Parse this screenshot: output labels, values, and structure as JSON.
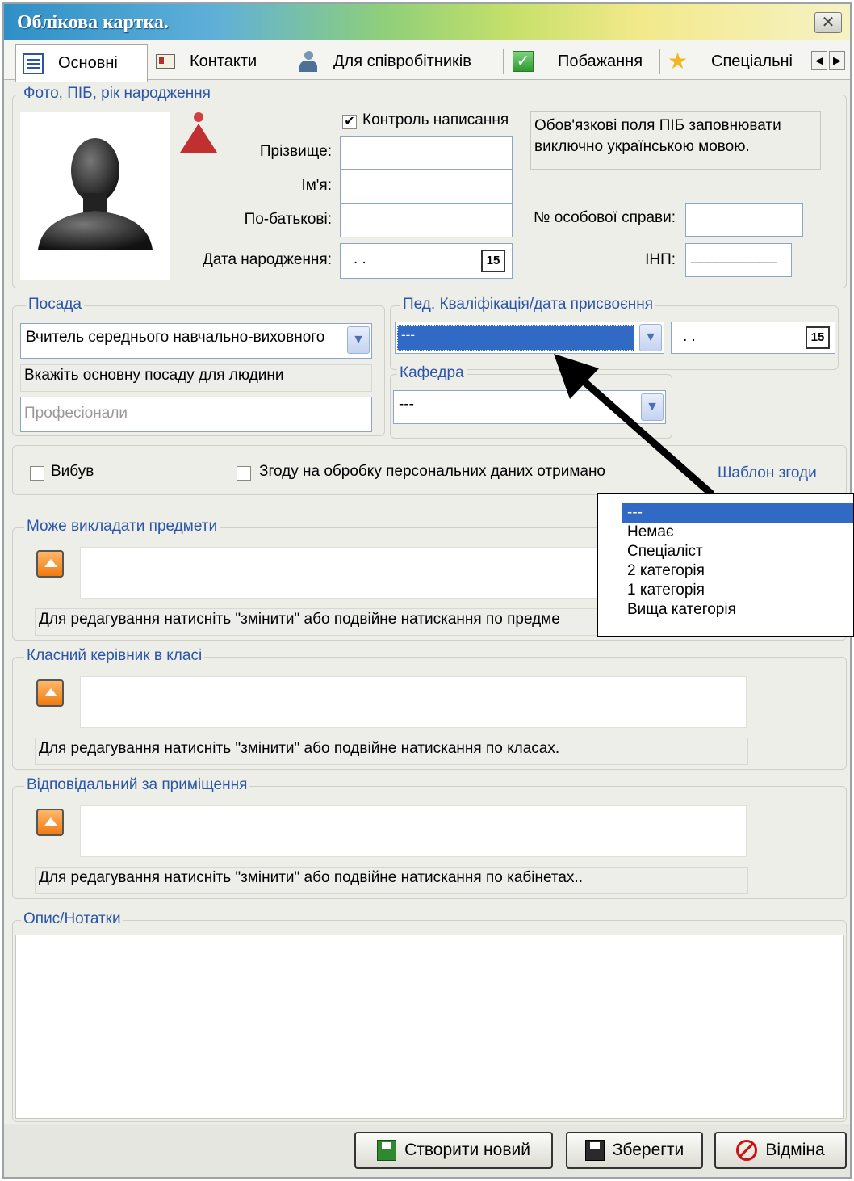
{
  "window": {
    "title": "Облікова картка.",
    "close": "✕"
  },
  "tabs": [
    {
      "label": "Основні",
      "icon": "document-icon"
    },
    {
      "label": "Контакти",
      "icon": "contact-card-icon"
    },
    {
      "label": "Для співробітників",
      "icon": "user-icon"
    },
    {
      "label": "Побажання",
      "icon": "checkmark-icon"
    },
    {
      "label": "Спеціальні",
      "icon": "star-icon"
    }
  ],
  "photo_group": {
    "label": "Фото, ПІБ, рік народження",
    "spell_check": "Контроль написання",
    "spell_check_checked": true,
    "note": "Обов'язкові поля ПІБ заповнювати виключно українською мовою.",
    "surname_label": "Прізвище:",
    "name_label": "Ім'я:",
    "patronymic_label": "По-батькові:",
    "birthdate_label": "Дата народження:",
    "birthdate_value": ". .",
    "file_no_label": "№ особової справи:",
    "inn_label": "ІНП:",
    "inn_value": "__________",
    "calendar_label": "15"
  },
  "position_group": {
    "label": "Посада",
    "value": "Вчитель середнього навчально-виховного",
    "hint": "Вкажіть основну посаду для людини",
    "category": "Професіонали"
  },
  "qualification_group": {
    "label": "Пед. Кваліфікація/дата присвоєння",
    "value": "---",
    "date_value": ". .",
    "calendar_label": "15"
  },
  "department_group": {
    "label": "Кафедра",
    "value": "---"
  },
  "retired_label": "Вибув",
  "consent_label": "Згоду на обробку персональних даних отримано",
  "consent_template_link": "Шаблон згоди",
  "subjects_group": {
    "label": "Може викладати предмети",
    "hint": "Для редагування натисніть \"змінити\" або подвійне натискання по предме"
  },
  "class_group": {
    "label": "Класний керівник в класі",
    "hint": "Для редагування натисніть \"змінити\" або подвійне натискання по класах."
  },
  "rooms_group": {
    "label": "Відповідальний за приміщення",
    "hint": "Для редагування натисніть \"змінити\" або подвійне натискання по кабінетах.."
  },
  "notes_group": {
    "label": "Опис/Нотатки"
  },
  "qualification_options": [
    "---",
    "Немає",
    "Спеціаліст",
    "2 категорія",
    "1 категорія",
    "Вища категорія"
  ],
  "buttons": {
    "create": "Створити новий",
    "save": "Зберегти",
    "cancel": "Відміна"
  }
}
